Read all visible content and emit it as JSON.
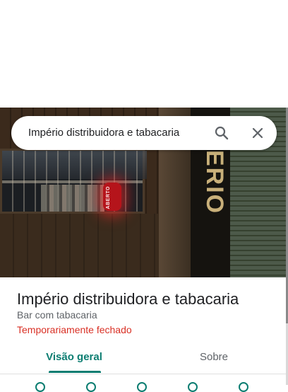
{
  "photo": {
    "neon_sign_text": "ABERTO",
    "wall_sign_text": "ERIO"
  },
  "search": {
    "query": "Império distribuidora e tabacaria",
    "search_icon": "search-icon",
    "close_icon": "close-icon"
  },
  "place": {
    "name": "Império distribuidora e tabacaria",
    "category": "Bar com tabacaria",
    "status": "Temporariamente fechado"
  },
  "tabs": [
    {
      "label": "Visão geral",
      "selected": true
    },
    {
      "label": "Sobre",
      "selected": false
    }
  ],
  "colors": {
    "accent": "#0b7d71",
    "status_closed": "#d93025",
    "text_primary": "#202124",
    "text_secondary": "#5f6368"
  }
}
